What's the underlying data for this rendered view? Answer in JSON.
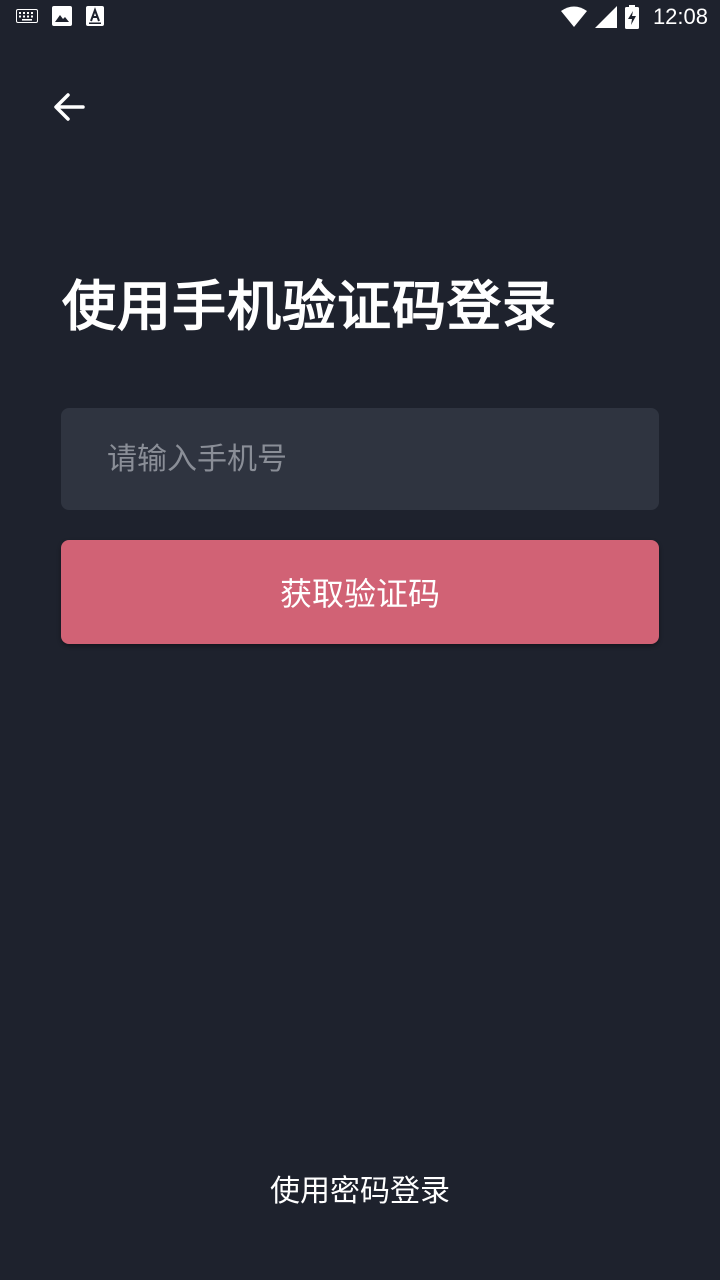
{
  "status_bar": {
    "time": "12:08",
    "icons": [
      "keyboard-icon",
      "image-icon",
      "font-icon",
      "wifi-icon",
      "signal-icon",
      "battery-charging-icon"
    ]
  },
  "header": {
    "back_icon": "arrow-left-icon"
  },
  "main": {
    "title": "使用手机验证码登录",
    "phone_input": {
      "value": "",
      "placeholder": "请输入手机号"
    },
    "get_code_label": "获取验证码"
  },
  "footer": {
    "password_login_label": "使用密码登录"
  },
  "colors": {
    "background": "#1e222d",
    "input_bg": "#2f3440",
    "accent": "#d16275",
    "placeholder": "#8a8e97"
  }
}
